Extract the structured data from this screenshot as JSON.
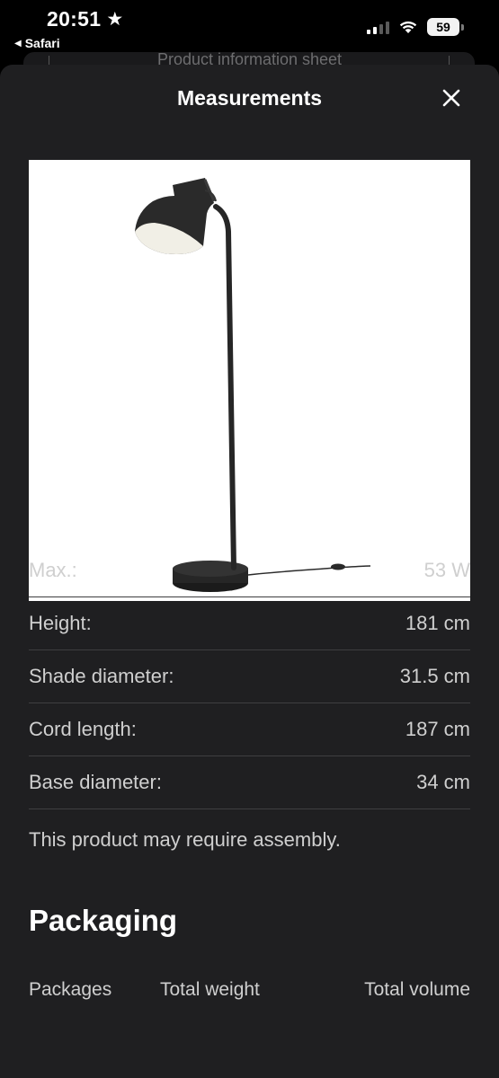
{
  "status_bar": {
    "time": "20:51",
    "back_app": "Safari",
    "battery": "59"
  },
  "background_page": {
    "title": "Product information sheet"
  },
  "modal": {
    "title": "Measurements",
    "close_icon": "close-icon"
  },
  "product_image": {
    "alt": "Floor lamp"
  },
  "specs": [
    {
      "label": "Max.:",
      "value": "53 W"
    },
    {
      "label": "Height:",
      "value": "181 cm"
    },
    {
      "label": "Shade diameter:",
      "value": "31.5 cm"
    },
    {
      "label": "Cord length:",
      "value": "187 cm"
    },
    {
      "label": "Base diameter:",
      "value": "34 cm"
    }
  ],
  "assembly_note": "This product may require assembly.",
  "packaging": {
    "heading": "Packaging",
    "columns": [
      "Packages",
      "Total weight",
      "Total volume"
    ]
  }
}
